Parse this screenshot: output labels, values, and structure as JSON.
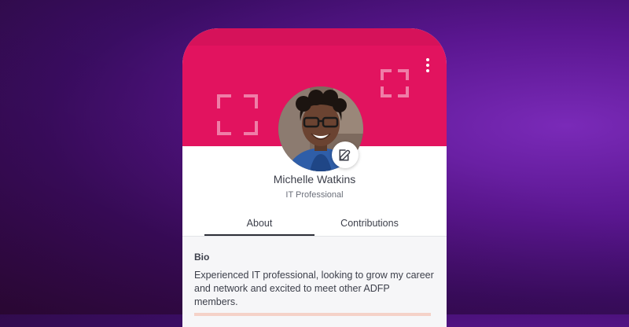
{
  "profile": {
    "name": "Michelle Watkins",
    "role": "IT Professional"
  },
  "tabs": [
    {
      "label": "About",
      "active": true
    },
    {
      "label": "Contributions",
      "active": false
    }
  ],
  "bio": {
    "title": "Bio",
    "text": "Experienced IT professional, looking to grow my career and network and excited to meet other ADFP members."
  },
  "icons": {
    "menu": "more-vertical-icon",
    "edit": "edit-icon"
  },
  "colors": {
    "header": "#e2135f",
    "header_topbar": "#d6125a",
    "text": "#3c3f4a",
    "subtle_text": "#6b6f7a",
    "background_purple": "#5a1690"
  }
}
